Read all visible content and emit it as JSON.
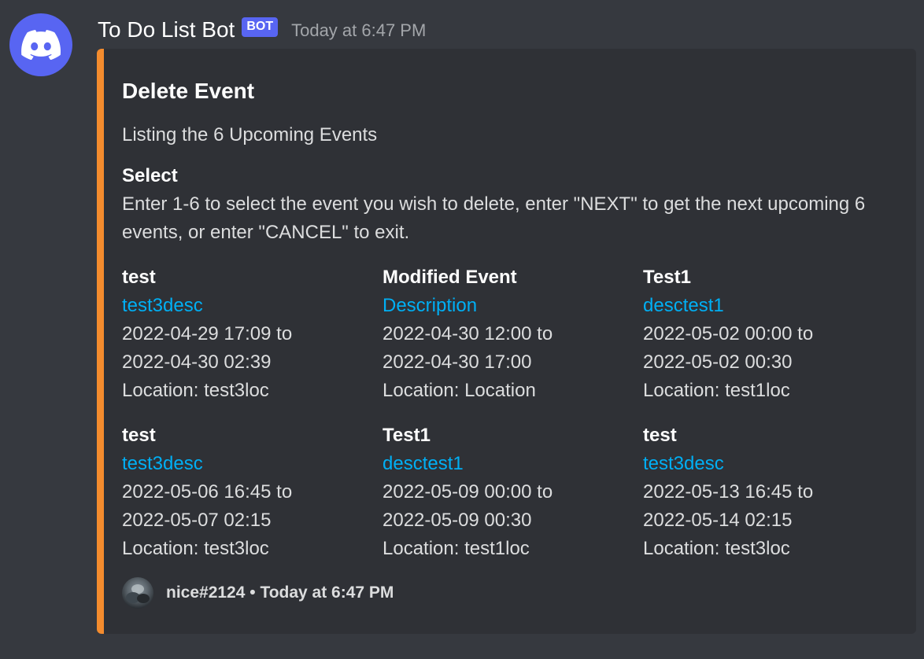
{
  "message": {
    "author": "To Do List Bot",
    "bot_tag": "BOT",
    "timestamp": "Today at 6:47 PM",
    "accent_color": "#f48c2e",
    "avatar_icon": "discord-logo-icon"
  },
  "embed": {
    "title": "Delete Event",
    "description": "Listing the 6 Upcoming Events",
    "select": {
      "name": "Select",
      "value": "Enter 1-6 to select the event you wish to delete, enter \"NEXT\" to get the next upcoming 6 events, or enter \"CANCEL\" to exit."
    },
    "events": [
      {
        "name": "test",
        "desc": "test3desc",
        "start": "2022-04-29 17:09 to",
        "end": "2022-04-30 02:39",
        "location": "Location: test3loc"
      },
      {
        "name": "Modified Event",
        "desc": "Description",
        "start": "2022-04-30 12:00 to",
        "end": "2022-04-30 17:00",
        "location": "Location: Location"
      },
      {
        "name": "Test1",
        "desc": "desctest1",
        "start": "2022-05-02 00:00 to",
        "end": "2022-05-02 00:30",
        "location": "Location: test1loc"
      },
      {
        "name": "test",
        "desc": "test3desc",
        "start": "2022-05-06 16:45 to",
        "end": "2022-05-07 02:15",
        "location": "Location: test3loc"
      },
      {
        "name": "Test1",
        "desc": "desctest1",
        "start": "2022-05-09 00:00 to",
        "end": "2022-05-09 00:30",
        "location": "Location: test1loc"
      },
      {
        "name": "test",
        "desc": "test3desc",
        "start": "2022-05-13 16:45 to",
        "end": "2022-05-14 02:15",
        "location": "Location: test3loc"
      }
    ],
    "footer": {
      "text": "nice#2124 • Today at 6:47 PM",
      "icon": "user-avatar-icon"
    }
  }
}
